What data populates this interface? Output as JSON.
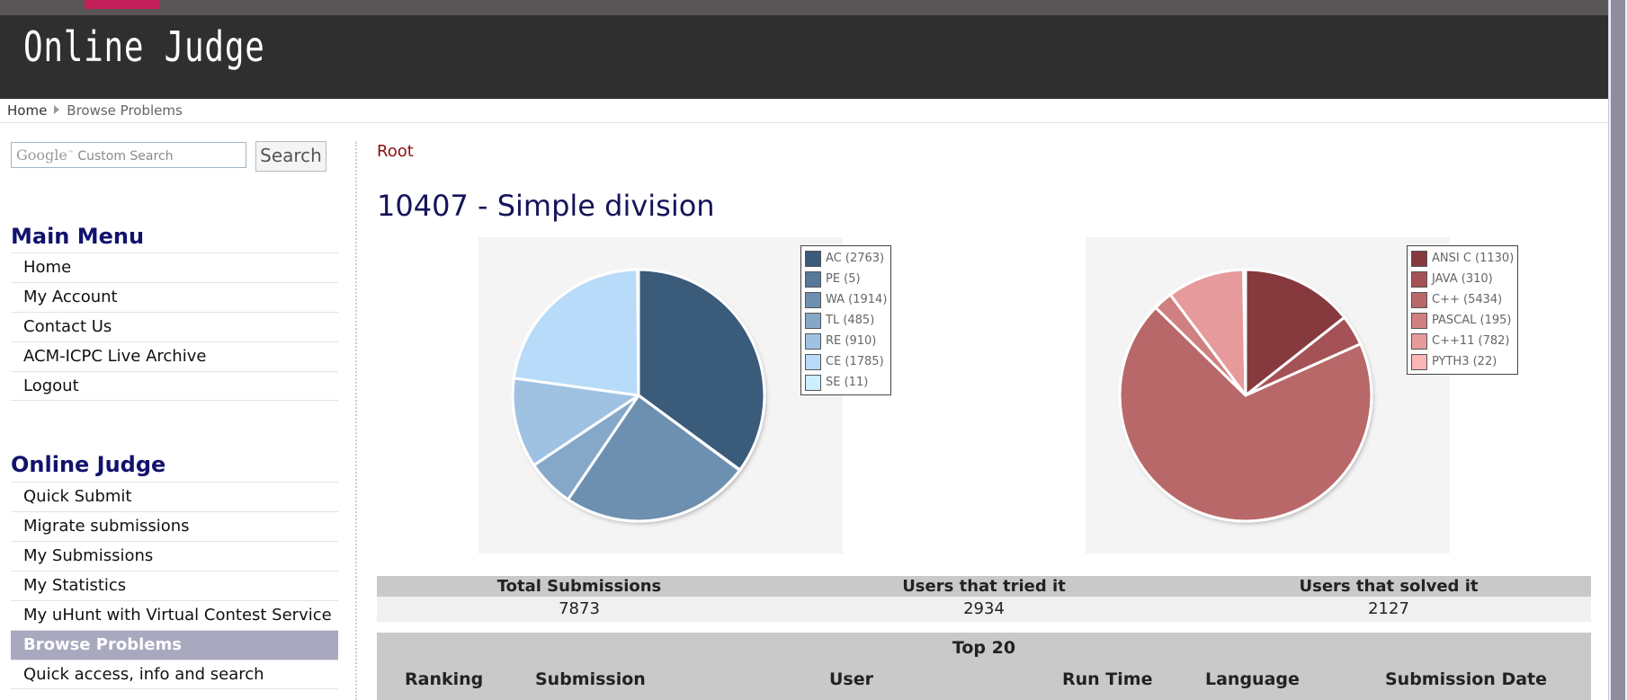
{
  "header": {
    "logo": "Online Judge"
  },
  "breadcrumb": {
    "home": "Home",
    "current": "Browse Problems"
  },
  "search": {
    "placeholder_brand": "Google",
    "placeholder_text": "Custom Search",
    "button_label": "Search"
  },
  "main_menu": {
    "heading": "Main Menu",
    "items": [
      "Home",
      "My Account",
      "Contact Us",
      "ACM-ICPC Live Archive",
      "Logout"
    ]
  },
  "oj_menu": {
    "heading": "Online Judge",
    "items": [
      "Quick Submit",
      "Migrate submissions",
      "My Submissions",
      "My Statistics",
      "My uHunt with Virtual Contest Service",
      "Browse Problems",
      "Quick access, info and search"
    ],
    "active": "Browse Problems"
  },
  "content": {
    "root_link": "Root",
    "problem_title": "10407 - Simple division"
  },
  "chart_data": [
    {
      "type": "pie",
      "categories": [
        "AC (2763)",
        "PE (5)",
        "WA (1914)",
        "TL (485)",
        "RE (910)",
        "CE (1785)",
        "SE (11)"
      ],
      "values": [
        2763,
        5,
        1914,
        485,
        910,
        1785,
        11
      ],
      "colors": [
        "#3b5b7b",
        "#56799a",
        "#6e90b0",
        "#86a8c8",
        "#a0c2e2",
        "#b8dbf9",
        "#cdeefe"
      ]
    },
    {
      "type": "pie",
      "categories": [
        "ANSI C (1130)",
        "JAVA (310)",
        "C++ (5434)",
        "PASCAL (195)",
        "C++11 (782)",
        "PYTH3 (22)"
      ],
      "values": [
        1130,
        310,
        5434,
        195,
        782,
        22
      ],
      "colors": [
        "#873a3d",
        "#a45255",
        "#b96869",
        "#d08080",
        "#e69a9b",
        "#fbb6b8"
      ]
    }
  ],
  "stats": {
    "headers": [
      "Total Submissions",
      "Users that tried it",
      "Users that solved it"
    ],
    "values": [
      "7873",
      "2934",
      "2127"
    ]
  },
  "top20": {
    "title": "Top 20",
    "columns": [
      "Ranking",
      "Submission",
      "User",
      "Run Time",
      "Language",
      "Submission Date"
    ]
  }
}
